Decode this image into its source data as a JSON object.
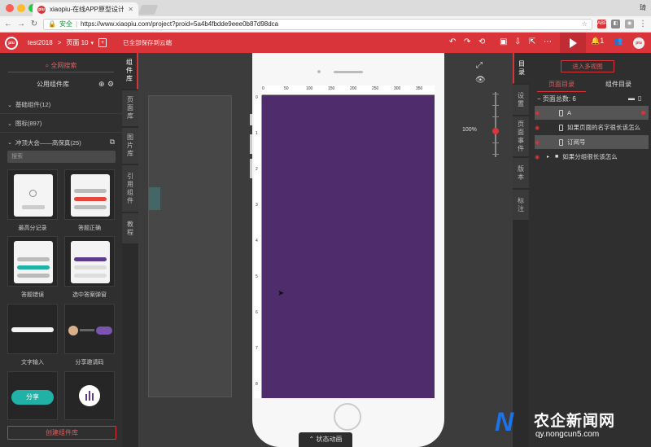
{
  "browser": {
    "tab_title": "xiaopiu-在线APP原型设计",
    "tab_favicon": "piu",
    "user_initial": "琦",
    "secure_label": "安全",
    "url": "https://www.xiaopiu.com/project?proid=5a4b4fbdde9eee0b87d98dca"
  },
  "header": {
    "logo": "piu",
    "project_name": "test2018",
    "separator": ">",
    "page_name": "页面 10",
    "save_status": "已全部保存到云端",
    "notif_count": "1",
    "accent": "#d9343a"
  },
  "left_panel": {
    "search_label": "全网搜索",
    "library_title": "公用组件库",
    "sections": [
      {
        "label": "基础组件(12)"
      },
      {
        "label": "图标(897)"
      },
      {
        "label": "冲顶大会——高保真(25)"
      }
    ],
    "search_placeholder": "搜索",
    "components": [
      {
        "label": "最高分记录"
      },
      {
        "label": "答题正确"
      },
      {
        "label": "答题错误"
      },
      {
        "label": "选中答案弹窗"
      },
      {
        "label": "文字输入"
      },
      {
        "label": "分享邀请码"
      },
      {
        "label": "分享"
      }
    ],
    "create_button": "创建组件库"
  },
  "left_tabs": [
    {
      "label": "组件库"
    },
    {
      "label": "页面库"
    },
    {
      "label": "图片库"
    },
    {
      "label": "引用组件"
    },
    {
      "label": "教程"
    }
  ],
  "canvas": {
    "ruler_top_ticks": [
      "0",
      "50",
      "100",
      "150",
      "200",
      "250",
      "300",
      "350"
    ],
    "ruler_left_ticks": [
      "0",
      "1",
      "2",
      "3",
      "4",
      "5",
      "6",
      "7",
      "8"
    ],
    "zoom_label": "100%",
    "bottom_tab": "状态动画",
    "screen_color": "#4f2d6c"
  },
  "right_tabs": [
    {
      "label": "目录"
    },
    {
      "label": "设置"
    },
    {
      "label": "页面事件"
    },
    {
      "label": "版本"
    },
    {
      "label": "标注"
    }
  ],
  "right_panel": {
    "multi_view_button": "进入多视图",
    "tab_pages": "页面目录",
    "tab_components": "组件目录",
    "page_count": "页面总数: 6",
    "pages": [
      {
        "label": "A"
      },
      {
        "label": "如果页面的名字很长该怎么"
      },
      {
        "label": "订阅号"
      },
      {
        "label": "如果分组很长该怎么"
      }
    ]
  },
  "watermark": {
    "cn": "农企新闻网",
    "url": "qy.nongcun5.com"
  }
}
